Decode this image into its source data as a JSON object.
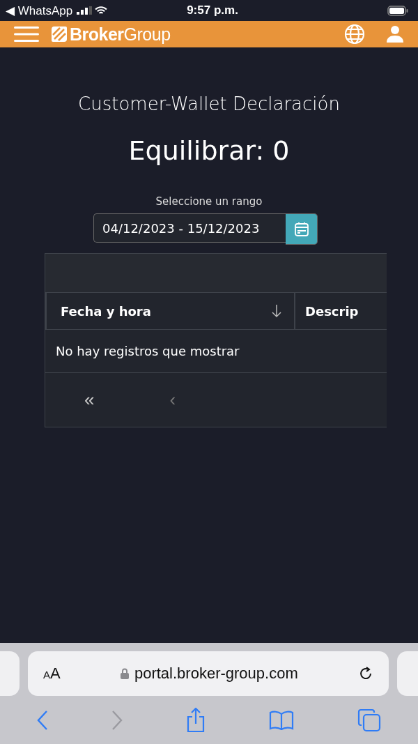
{
  "status_bar": {
    "back_app": "◀ WhatsApp",
    "time": "9:57 p.m."
  },
  "header": {
    "brand": "**Broker**Group"
  },
  "page": {
    "title": "Customer-Wallet Declaración",
    "balance": "Equilibrar: 0"
  },
  "date_range": {
    "label": "Seleccione un rango",
    "value": "04/12/2023 - 15/12/2023"
  },
  "table": {
    "columns": [
      {
        "label": "Fecha y hora",
        "sorted_descending": true
      },
      {
        "label": "Descrip",
        "sorted_descending": false
      }
    ],
    "empty_message": "No hay registros que mostrar",
    "pagination": [
      {
        "glyph": "«",
        "disabled": false
      },
      {
        "glyph": "‹",
        "disabled": true
      }
    ]
  },
  "browser": {
    "text_size": "AA",
    "url": "portal.broker-group.com",
    "toolbar": [
      {
        "kind": "back",
        "disabled": false
      },
      {
        "kind": "forward",
        "disabled": true
      },
      {
        "kind": "share",
        "disabled": false
      },
      {
        "kind": "bookmarks",
        "disabled": false
      },
      {
        "kind": "tabs",
        "disabled": false
      }
    ]
  }
}
